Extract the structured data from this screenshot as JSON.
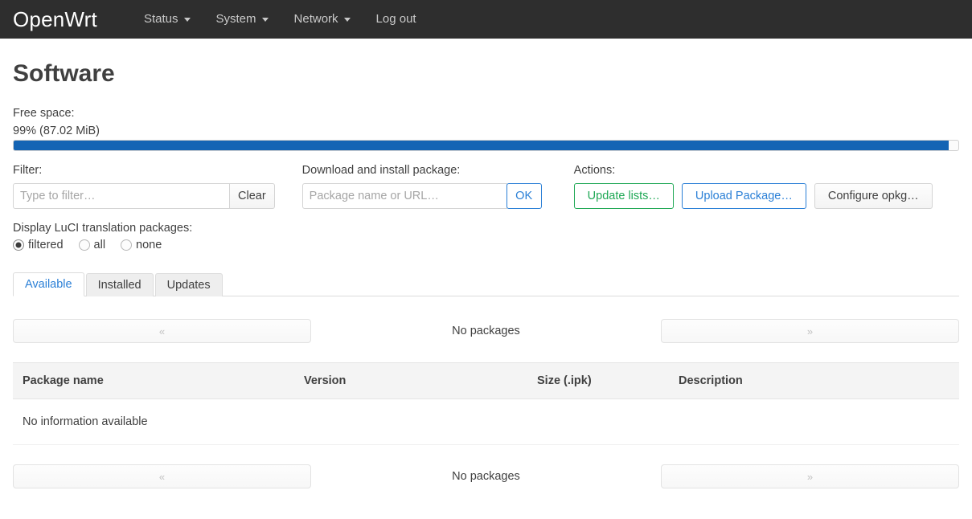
{
  "header": {
    "brand": "OpenWrt",
    "nav": [
      {
        "label": "Status",
        "has_caret": true
      },
      {
        "label": "System",
        "has_caret": true
      },
      {
        "label": "Network",
        "has_caret": true
      },
      {
        "label": "Log out",
        "has_caret": false
      }
    ]
  },
  "page": {
    "title": "Software"
  },
  "free_space": {
    "label": "Free space:",
    "value": "99% (87.02 MiB)",
    "percent": 99,
    "bar_color": "#1464b4"
  },
  "filter": {
    "label": "Filter:",
    "placeholder": "Type to filter…",
    "value": "",
    "clear_label": "Clear"
  },
  "download": {
    "label": "Download and install package:",
    "placeholder": "Package name or URL…",
    "value": "",
    "ok_label": "OK"
  },
  "actions": {
    "label": "Actions:",
    "buttons": [
      {
        "label": "Update lists…",
        "style": "apply",
        "color": "#1fa855"
      },
      {
        "label": "Upload Package…",
        "style": "action",
        "color": "#2a7fd6"
      },
      {
        "label": "Configure opkg…",
        "style": "neutral",
        "color": "#404040"
      }
    ]
  },
  "translation": {
    "label": "Display LuCI translation packages:",
    "options": [
      {
        "label": "filtered",
        "checked": true
      },
      {
        "label": "all",
        "checked": false
      },
      {
        "label": "none",
        "checked": false
      }
    ]
  },
  "tabs": [
    {
      "label": "Available",
      "active": true
    },
    {
      "label": "Installed",
      "active": false
    },
    {
      "label": "Updates",
      "active": false
    }
  ],
  "pager_top": {
    "prev": "«",
    "status": "No packages",
    "next": "»"
  },
  "pager_bottom": {
    "prev": "«",
    "status": "No packages",
    "next": "»"
  },
  "table": {
    "columns": [
      "Package name",
      "Version",
      "Size (.ipk)",
      "Description"
    ],
    "empty_message": "No information available"
  }
}
